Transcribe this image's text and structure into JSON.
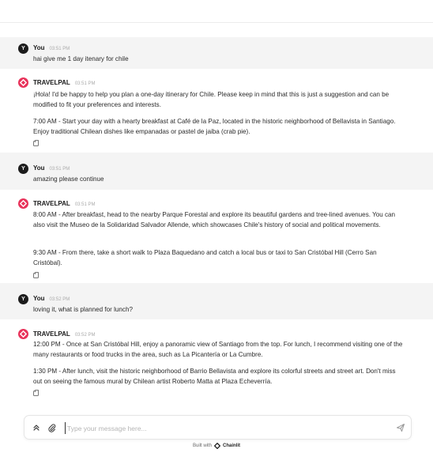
{
  "colors": {
    "bot_accent": "#e8325a",
    "user_bg": "#f4f4f4",
    "user_avatar": "#1c1c1c"
  },
  "user": {
    "name": "You",
    "initial": "Y"
  },
  "bot": {
    "name": "TRAVELPAL",
    "icon": "chainlit-logo-icon"
  },
  "messages": [
    {
      "role": "user",
      "time": "03:51 PM",
      "paragraphs": [
        "hai give me 1 day itenary for chile"
      ]
    },
    {
      "role": "bot",
      "time": "03:51 PM",
      "paragraphs": [
        "¡Hola! I'd be happy to help you plan a one-day itinerary for Chile. Please keep in mind that this is just a suggestion and can be modified to fit your preferences and interests.",
        "7:00 AM - Start your day with a hearty breakfast at Café de la Paz, located in the historic neighborhood of Bellavista in Santiago. Enjoy traditional Chilean dishes like empanadas or pastel de jaiba (crab pie)."
      ]
    },
    {
      "role": "user",
      "time": "03:51 PM",
      "paragraphs": [
        "amazing please continue"
      ]
    },
    {
      "role": "bot",
      "time": "03:51 PM",
      "paragraphs": [
        "8:00 AM - After breakfast, head to the nearby Parque Forestal and explore its beautiful gardens and tree-lined avenues. You can also visit the Museo de la Solidaridad Salvador Allende, which showcases Chile's history of social and political movements.",
        "9:30 AM - From there, take a short walk to Plaza Baquedano and catch a local bus or taxi to San Cristóbal Hill (Cerro San Cristóbal)."
      ]
    },
    {
      "role": "user",
      "time": "03:52 PM",
      "paragraphs": [
        "loving it, what is planned for lunch?"
      ]
    },
    {
      "role": "bot",
      "time": "03:52 PM",
      "paragraphs": [
        "12:00 PM - Once at San Cristóbal Hill, enjoy a panoramic view of Santiago from the top. For lunch, I recommend visiting one of the many restaurants or food trucks in the area, such as La Picantería or La Cumbre.",
        "1:30 PM - After lunch, visit the historic neighborhood of Barrio Bellavista and explore its colorful streets and street art. Don't miss out on seeing the famous mural by Chilean artist Roberto Matta at Plaza Echeverría."
      ]
    }
  ],
  "composer": {
    "placeholder": "Type your message here...",
    "value": ""
  },
  "footer": {
    "built_with": "Built with",
    "brand": "Chainlit"
  }
}
